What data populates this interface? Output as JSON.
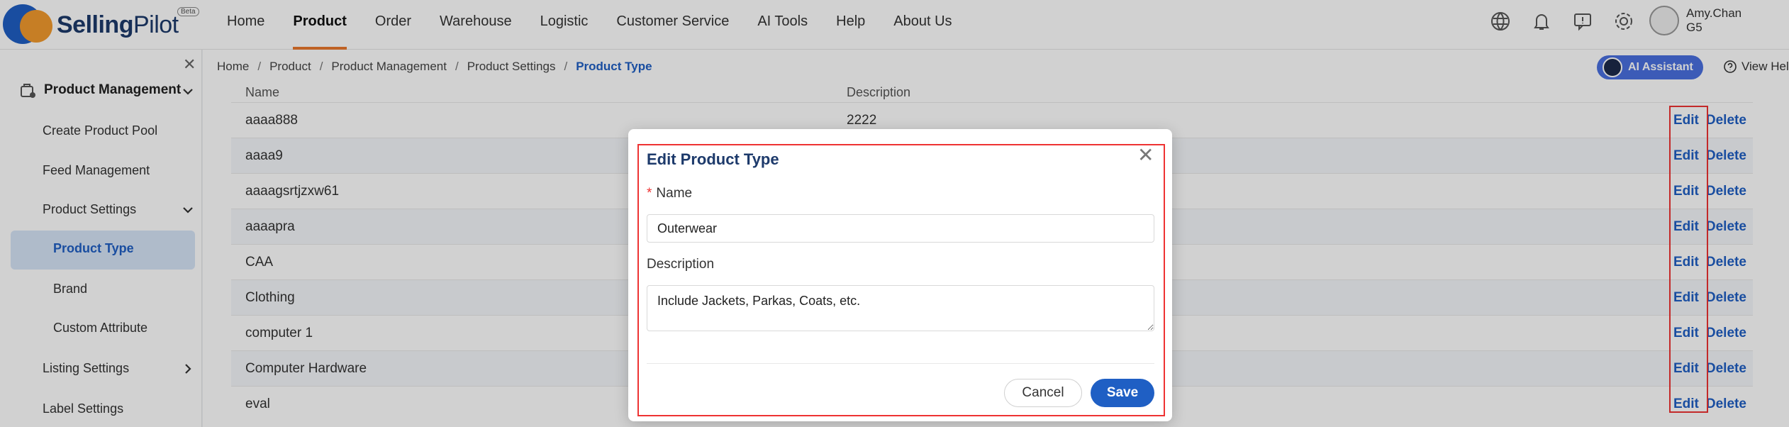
{
  "brand": {
    "name_bold": "Selling",
    "name_rest": "Pilot",
    "badge": "Beta"
  },
  "nav": {
    "items": [
      "Home",
      "Product",
      "Order",
      "Warehouse",
      "Logistic",
      "Customer Service",
      "AI Tools",
      "Help",
      "About Us"
    ],
    "active": "Product"
  },
  "user": {
    "line1": "Amy.Chan",
    "line2": "G5"
  },
  "top_icons": [
    "globe-icon",
    "bell-icon",
    "feedback-icon",
    "settings-icon"
  ],
  "sidebar": {
    "group": "Product Management",
    "items": {
      "create_pool": "Create Product Pool",
      "feed": "Feed Management",
      "settings": "Product Settings",
      "type": "Product Type",
      "brand": "Brand",
      "custom_attr": "Custom Attribute",
      "listing": "Listing Settings",
      "label": "Label Settings"
    }
  },
  "breadcrumb": [
    "Home",
    "Product",
    "Product Management",
    "Product Settings",
    "Product Type"
  ],
  "header_actions": {
    "ai": "AI Assistant",
    "help": "View Help"
  },
  "table": {
    "columns": {
      "name": "Name",
      "desc": "Description"
    },
    "edit_label": "Edit",
    "delete_label": "Delete",
    "rows": [
      {
        "name": "aaaa888",
        "desc": "2222"
      },
      {
        "name": "aaaa9",
        "desc": ""
      },
      {
        "name": "aaaagsrtjzxw61",
        "desc": ""
      },
      {
        "name": "aaaapra",
        "desc": ""
      },
      {
        "name": "CAA",
        "desc": ""
      },
      {
        "name": "Clothing",
        "desc": ""
      },
      {
        "name": "computer 1",
        "desc": ""
      },
      {
        "name": "Computer Hardware",
        "desc": ""
      },
      {
        "name": "eval",
        "desc": ""
      }
    ]
  },
  "modal": {
    "title": "Edit Product Type",
    "name_label": "Name",
    "required_mark": "*",
    "name_value": "Outerwear",
    "desc_label": "Description",
    "desc_value": "Include Jackets, Parkas, Coats, etc.",
    "cancel": "Cancel",
    "save": "Save"
  }
}
